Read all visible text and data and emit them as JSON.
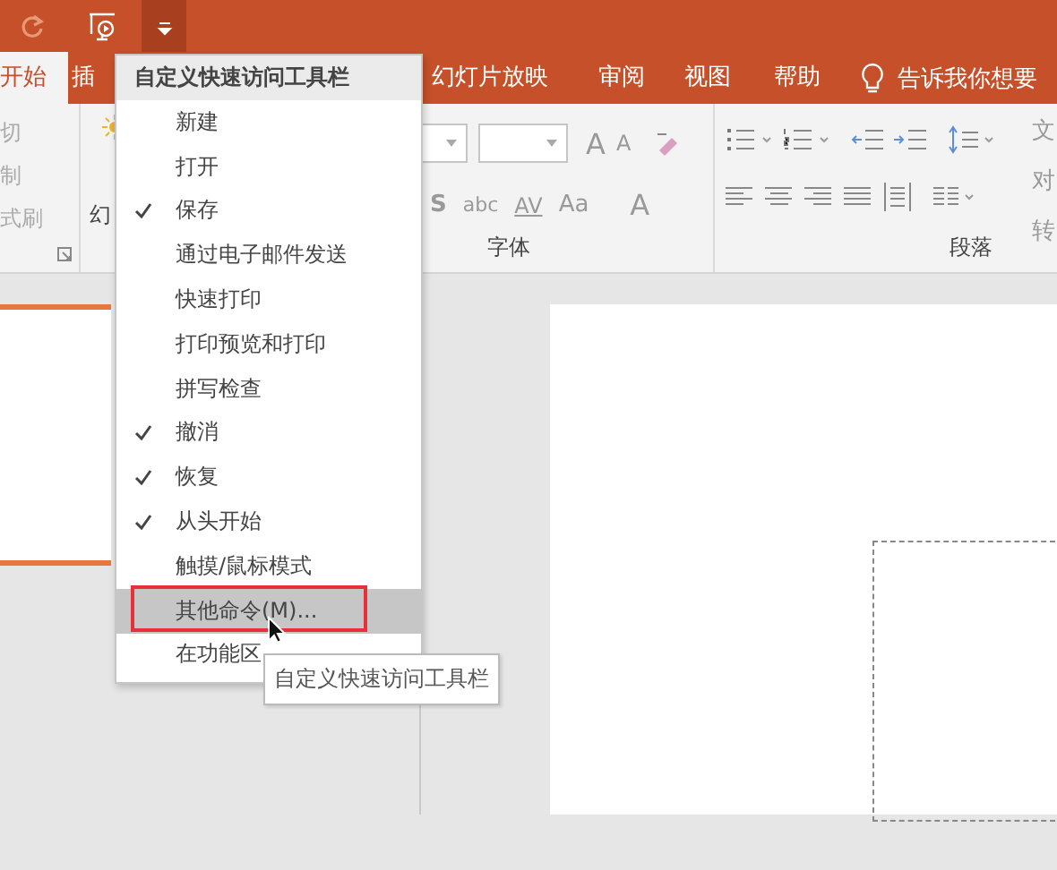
{
  "tabs": [
    {
      "label": "开始",
      "selected": true
    },
    {
      "label": "插",
      "selected": false
    },
    {
      "label": "幻灯片放映",
      "selected": false
    },
    {
      "label": "审阅",
      "selected": false
    },
    {
      "label": "视图",
      "selected": false
    },
    {
      "label": "帮助",
      "selected": false
    }
  ],
  "tell_me": {
    "text": "告诉我你想要"
  },
  "ribbon": {
    "clipboard": [
      "切",
      "制",
      "式刷"
    ],
    "slides": {
      "label": "幻"
    },
    "font": {
      "label": "字体",
      "row1": [
        "A",
        "A"
      ],
      "row2": [
        "S",
        "abc",
        "AV",
        "Aa",
        "A"
      ]
    },
    "paragraph": {
      "label": "段落",
      "side": [
        "文",
        "对",
        "转"
      ]
    }
  },
  "menu": {
    "title": "自定义快速访问工具栏",
    "items": [
      {
        "label": "新建",
        "checked": false,
        "selected": false
      },
      {
        "label": "打开",
        "checked": false,
        "selected": false
      },
      {
        "label": "保存",
        "checked": true,
        "selected": false
      },
      {
        "label": "通过电子邮件发送",
        "checked": false,
        "selected": false
      },
      {
        "label": "快速打印",
        "checked": false,
        "selected": false
      },
      {
        "label": "打印预览和打印",
        "checked": false,
        "selected": false
      },
      {
        "label": "拼写检查",
        "checked": false,
        "selected": false
      },
      {
        "label": "撤消",
        "checked": true,
        "selected": false
      },
      {
        "label": "恢复",
        "checked": true,
        "selected": false
      },
      {
        "label": "从头开始",
        "checked": true,
        "selected": false
      },
      {
        "label": "触摸/鼠标模式",
        "checked": false,
        "selected": false
      },
      {
        "label": "其他命令(M)...",
        "checked": false,
        "selected": true
      },
      {
        "label": "在功能区",
        "checked": false,
        "selected": false
      }
    ]
  },
  "tooltip": {
    "text": "自定义快速访问工具栏"
  }
}
